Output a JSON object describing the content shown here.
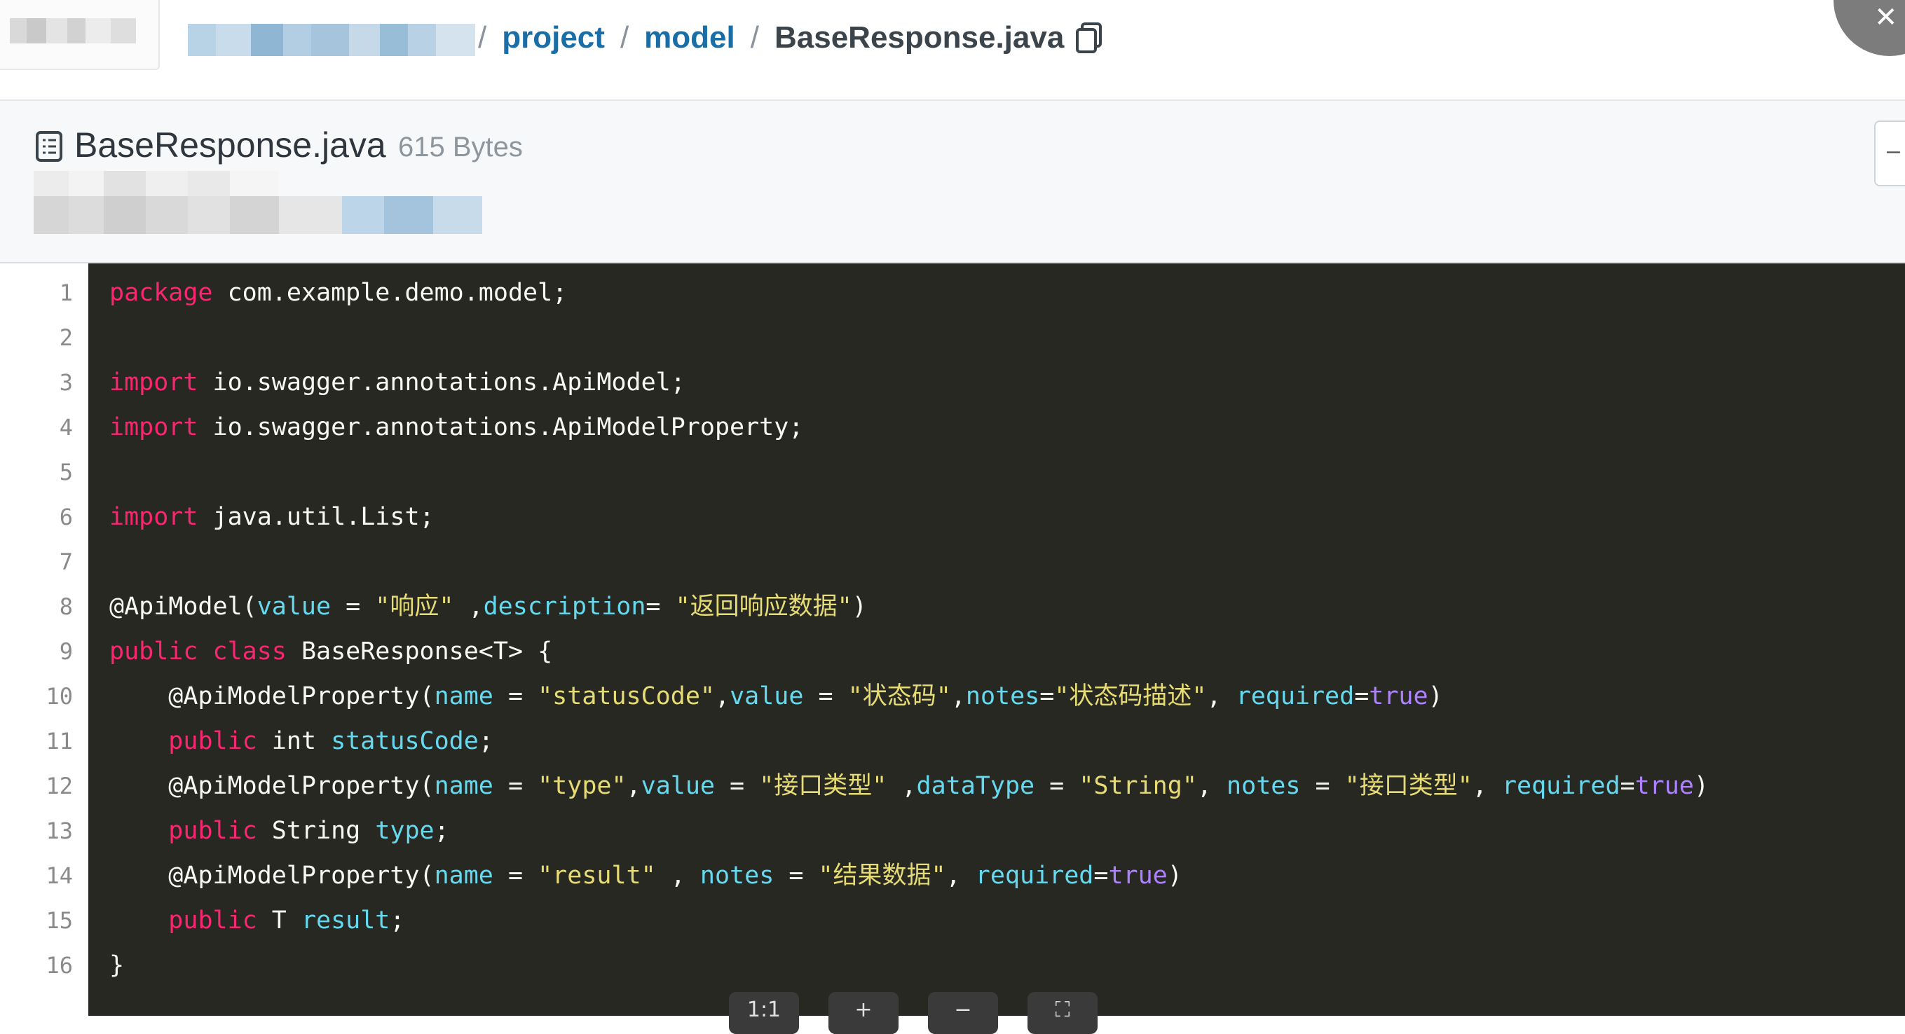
{
  "breadcrumb": {
    "items": [
      "project",
      "model"
    ],
    "current": "BaseResponse.java",
    "separator": "/"
  },
  "file": {
    "name": "BaseResponse.java",
    "size": "615 Bytes"
  },
  "code": {
    "lines": [
      {
        "n": "1",
        "tokens": [
          [
            "kw",
            "package"
          ],
          [
            "id",
            " com.example.demo.model;"
          ]
        ]
      },
      {
        "n": "2",
        "tokens": []
      },
      {
        "n": "3",
        "tokens": [
          [
            "kw",
            "import"
          ],
          [
            "id",
            " io.swagger.annotations.ApiModel;"
          ]
        ]
      },
      {
        "n": "4",
        "tokens": [
          [
            "kw",
            "import"
          ],
          [
            "id",
            " io.swagger.annotations.ApiModelProperty;"
          ]
        ]
      },
      {
        "n": "5",
        "tokens": []
      },
      {
        "n": "6",
        "tokens": [
          [
            "kw",
            "import"
          ],
          [
            "id",
            " java.util.List;"
          ]
        ]
      },
      {
        "n": "7",
        "tokens": []
      },
      {
        "n": "8",
        "tokens": [
          [
            "id",
            "@ApiModel("
          ],
          [
            "attr",
            "value"
          ],
          [
            "id",
            " = "
          ],
          [
            "str",
            "\"响应\""
          ],
          [
            "id",
            " ,"
          ],
          [
            "attr",
            "description"
          ],
          [
            "id",
            "= "
          ],
          [
            "str",
            "\"返回响应数据\""
          ],
          [
            "id",
            ")"
          ]
        ]
      },
      {
        "n": "9",
        "tokens": [
          [
            "kw",
            "public"
          ],
          [
            "id",
            " "
          ],
          [
            "kw",
            "class"
          ],
          [
            "id",
            " BaseResponse<T> {"
          ]
        ]
      },
      {
        "n": "10",
        "tokens": [
          [
            "id",
            "    @ApiModelProperty("
          ],
          [
            "attr",
            "name"
          ],
          [
            "id",
            " = "
          ],
          [
            "str",
            "\"statusCode\""
          ],
          [
            "id",
            ","
          ],
          [
            "attr",
            "value"
          ],
          [
            "id",
            " = "
          ],
          [
            "str",
            "\"状态码\""
          ],
          [
            "id",
            ","
          ],
          [
            "attr",
            "notes"
          ],
          [
            "id",
            "="
          ],
          [
            "str",
            "\"状态码描述\""
          ],
          [
            "id",
            ", "
          ],
          [
            "attr",
            "required"
          ],
          [
            "id",
            "="
          ],
          [
            "bool",
            "true"
          ],
          [
            "id",
            ")"
          ]
        ]
      },
      {
        "n": "11",
        "tokens": [
          [
            "id",
            "    "
          ],
          [
            "kw",
            "public"
          ],
          [
            "id",
            " int "
          ],
          [
            "attr",
            "statusCode"
          ],
          [
            "id",
            ";"
          ]
        ]
      },
      {
        "n": "12",
        "tokens": [
          [
            "id",
            "    @ApiModelProperty("
          ],
          [
            "attr",
            "name"
          ],
          [
            "id",
            " = "
          ],
          [
            "str",
            "\"type\""
          ],
          [
            "id",
            ","
          ],
          [
            "attr",
            "value"
          ],
          [
            "id",
            " = "
          ],
          [
            "str",
            "\"接口类型\""
          ],
          [
            "id",
            " ,"
          ],
          [
            "attr",
            "dataType"
          ],
          [
            "id",
            " = "
          ],
          [
            "str",
            "\"String\""
          ],
          [
            "id",
            ", "
          ],
          [
            "attr",
            "notes"
          ],
          [
            "id",
            " = "
          ],
          [
            "str",
            "\"接口类型\""
          ],
          [
            "id",
            ", "
          ],
          [
            "attr",
            "required"
          ],
          [
            "id",
            "="
          ],
          [
            "bool",
            "true"
          ],
          [
            "id",
            ")"
          ]
        ]
      },
      {
        "n": "13",
        "tokens": [
          [
            "id",
            "    "
          ],
          [
            "kw",
            "public"
          ],
          [
            "id",
            " String "
          ],
          [
            "attr",
            "type"
          ],
          [
            "id",
            ";"
          ]
        ]
      },
      {
        "n": "14",
        "tokens": [
          [
            "id",
            "    @ApiModelProperty("
          ],
          [
            "attr",
            "name"
          ],
          [
            "id",
            " = "
          ],
          [
            "str",
            "\"result\""
          ],
          [
            "id",
            " , "
          ],
          [
            "attr",
            "notes"
          ],
          [
            "id",
            " = "
          ],
          [
            "str",
            "\"结果数据\""
          ],
          [
            "id",
            ", "
          ],
          [
            "attr",
            "required"
          ],
          [
            "id",
            "="
          ],
          [
            "bool",
            "true"
          ],
          [
            "id",
            ")"
          ]
        ]
      },
      {
        "n": "15",
        "tokens": [
          [
            "id",
            "    "
          ],
          [
            "kw",
            "public"
          ],
          [
            "id",
            " T "
          ],
          [
            "attr",
            "result"
          ],
          [
            "id",
            ";"
          ]
        ]
      },
      {
        "n": "16",
        "tokens": [
          [
            "id",
            "}"
          ]
        ]
      }
    ]
  },
  "toolbar": {
    "reset_label": "1:1",
    "zoom_in_label": "+",
    "zoom_out_label": "−",
    "fit_label": "⛶"
  },
  "colors": {
    "link": "#1a6ea8",
    "code_bg": "#272822",
    "keyword": "#f92672",
    "string": "#e6db74",
    "attribute": "#66d9ef",
    "boolean": "#ae81ff"
  }
}
